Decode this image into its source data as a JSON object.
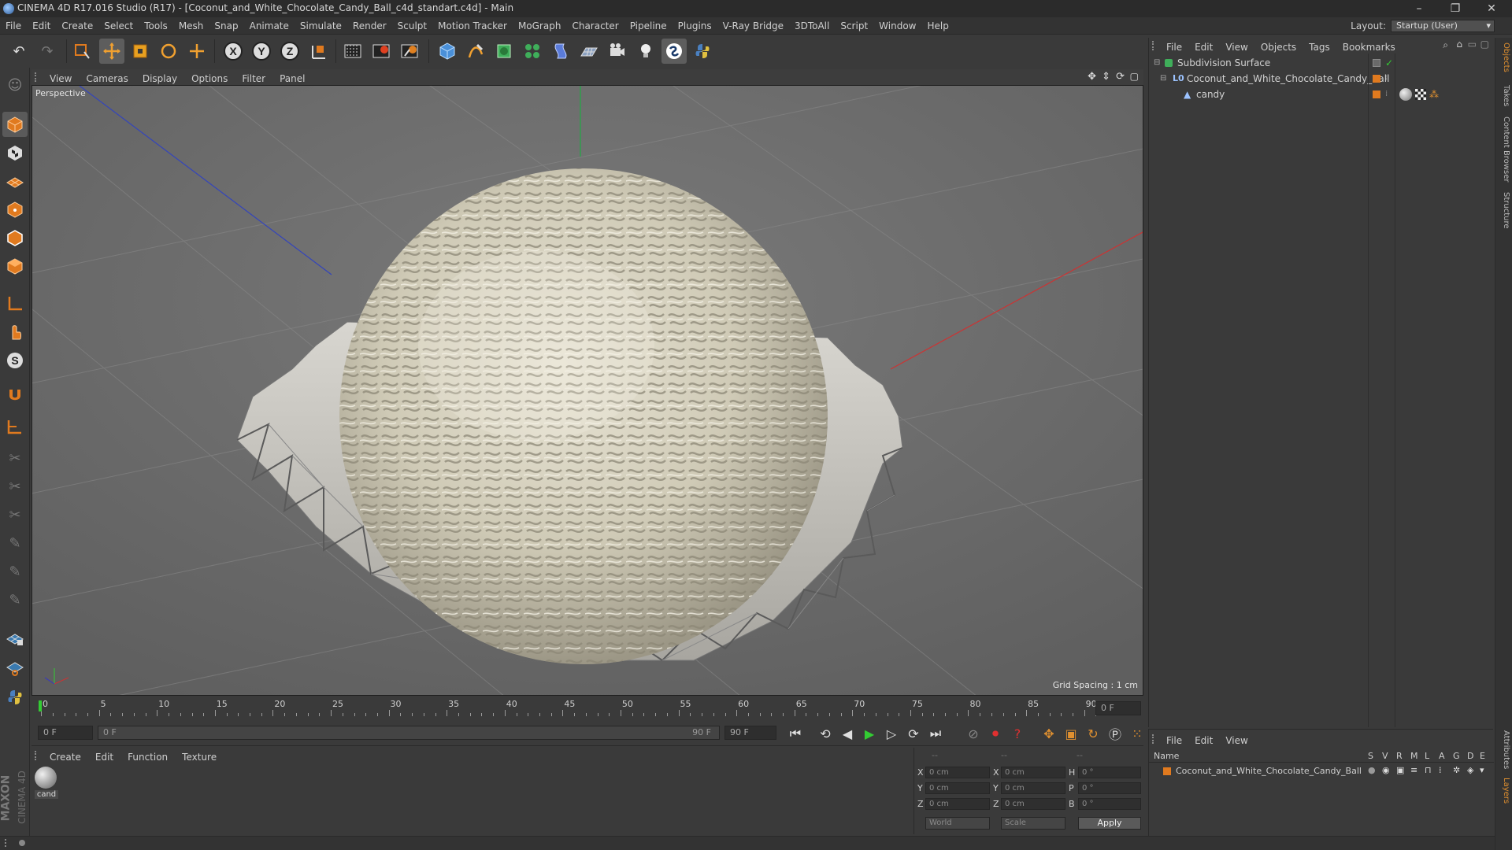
{
  "window": {
    "title": "CINEMA 4D R17.016 Studio (R17) - [Coconut_and_White_Chocolate_Candy_Ball_c4d_standart.c4d] - Main",
    "minimize": "–",
    "restore": "❐",
    "close": "✕"
  },
  "menubar": [
    "File",
    "Edit",
    "Create",
    "Select",
    "Tools",
    "Mesh",
    "Snap",
    "Animate",
    "Simulate",
    "Render",
    "Sculpt",
    "Motion Tracker",
    "MoGraph",
    "Character",
    "Pipeline",
    "Plugins",
    "V-Ray Bridge",
    "3DToAll",
    "Script",
    "Window",
    "Help"
  ],
  "layout": {
    "label": "Layout:",
    "value": "Startup (User)"
  },
  "toolbar_icons": [
    "undo-icon",
    "redo-icon",
    "live-selection-icon",
    "move-icon",
    "scale-icon",
    "rotate-icon",
    "transform-icon",
    "x-axis-icon",
    "y-axis-icon",
    "z-axis-icon",
    "coordinate-system-icon",
    "render-view-icon",
    "render-picture-viewer-icon",
    "edit-render-settings-icon",
    "cube-icon",
    "pen-icon",
    "subdivision-icon",
    "mograph-cloner-icon",
    "deformer-icon",
    "floor-icon",
    "camera-icon",
    "light-icon",
    "vray-icon",
    "python-icon"
  ],
  "axis_letters": {
    "x": "X",
    "y": "Y",
    "z": "Z"
  },
  "viewport": {
    "menu": [
      "View",
      "Cameras",
      "Display",
      "Options",
      "Filter",
      "Panel"
    ],
    "label": "Perspective",
    "grid_info": "Grid Spacing : 1 cm"
  },
  "timeline": {
    "ticks": [
      "0",
      "5",
      "10",
      "15",
      "20",
      "25",
      "30",
      "35",
      "40",
      "45",
      "50",
      "55",
      "60",
      "65",
      "70",
      "75",
      "80",
      "85",
      "90"
    ],
    "current_frame": "0 F",
    "start_field": "0 F",
    "range_start": "0 F",
    "range_end": "90 F",
    "end_field": "90 F"
  },
  "material_manager": {
    "menu": [
      "Create",
      "Edit",
      "Function",
      "Texture"
    ],
    "material_label": "cand"
  },
  "coordinates": {
    "header": [
      "--",
      "--",
      "--"
    ],
    "rows": [
      {
        "a": "X",
        "av": "0 cm",
        "b": "X",
        "bv": "0 cm",
        "c": "H",
        "cv": "0 °"
      },
      {
        "a": "Y",
        "av": "0 cm",
        "b": "Y",
        "bv": "0 cm",
        "c": "P",
        "cv": "0 °"
      },
      {
        "a": "Z",
        "av": "0 cm",
        "b": "Z",
        "bv": "0 cm",
        "c": "B",
        "cv": "0 °"
      }
    ],
    "mode": "World",
    "transform": "Scale",
    "apply": "Apply"
  },
  "object_manager": {
    "menu": [
      "File",
      "Edit",
      "View",
      "Objects",
      "Tags",
      "Bookmarks"
    ],
    "objects": [
      {
        "name": "Subdivision Surface",
        "indent": 0
      },
      {
        "name": "Coconut_and_White_Chocolate_Candy_Ball",
        "indent": 1
      },
      {
        "name": "candy",
        "indent": 2
      }
    ]
  },
  "layer_manager": {
    "menu": [
      "File",
      "Edit",
      "View"
    ],
    "header_name": "Name",
    "header_cols": [
      "S",
      "V",
      "R",
      "M",
      "L",
      "A",
      "G",
      "D",
      "E"
    ],
    "layer": "Coconut_and_White_Chocolate_Candy_Ball"
  },
  "side_tabs": [
    "Objects",
    "Takes",
    "Content Browser",
    "Structure",
    "Attributes",
    "Layers"
  ],
  "brand": {
    "maxon": "MAXON",
    "cinema": "CINEMA 4D"
  },
  "colors": {
    "accent_orange": "#e07a1f",
    "viewport_bg": "#6e6e6e",
    "panel_bg": "#3a3a3a"
  }
}
